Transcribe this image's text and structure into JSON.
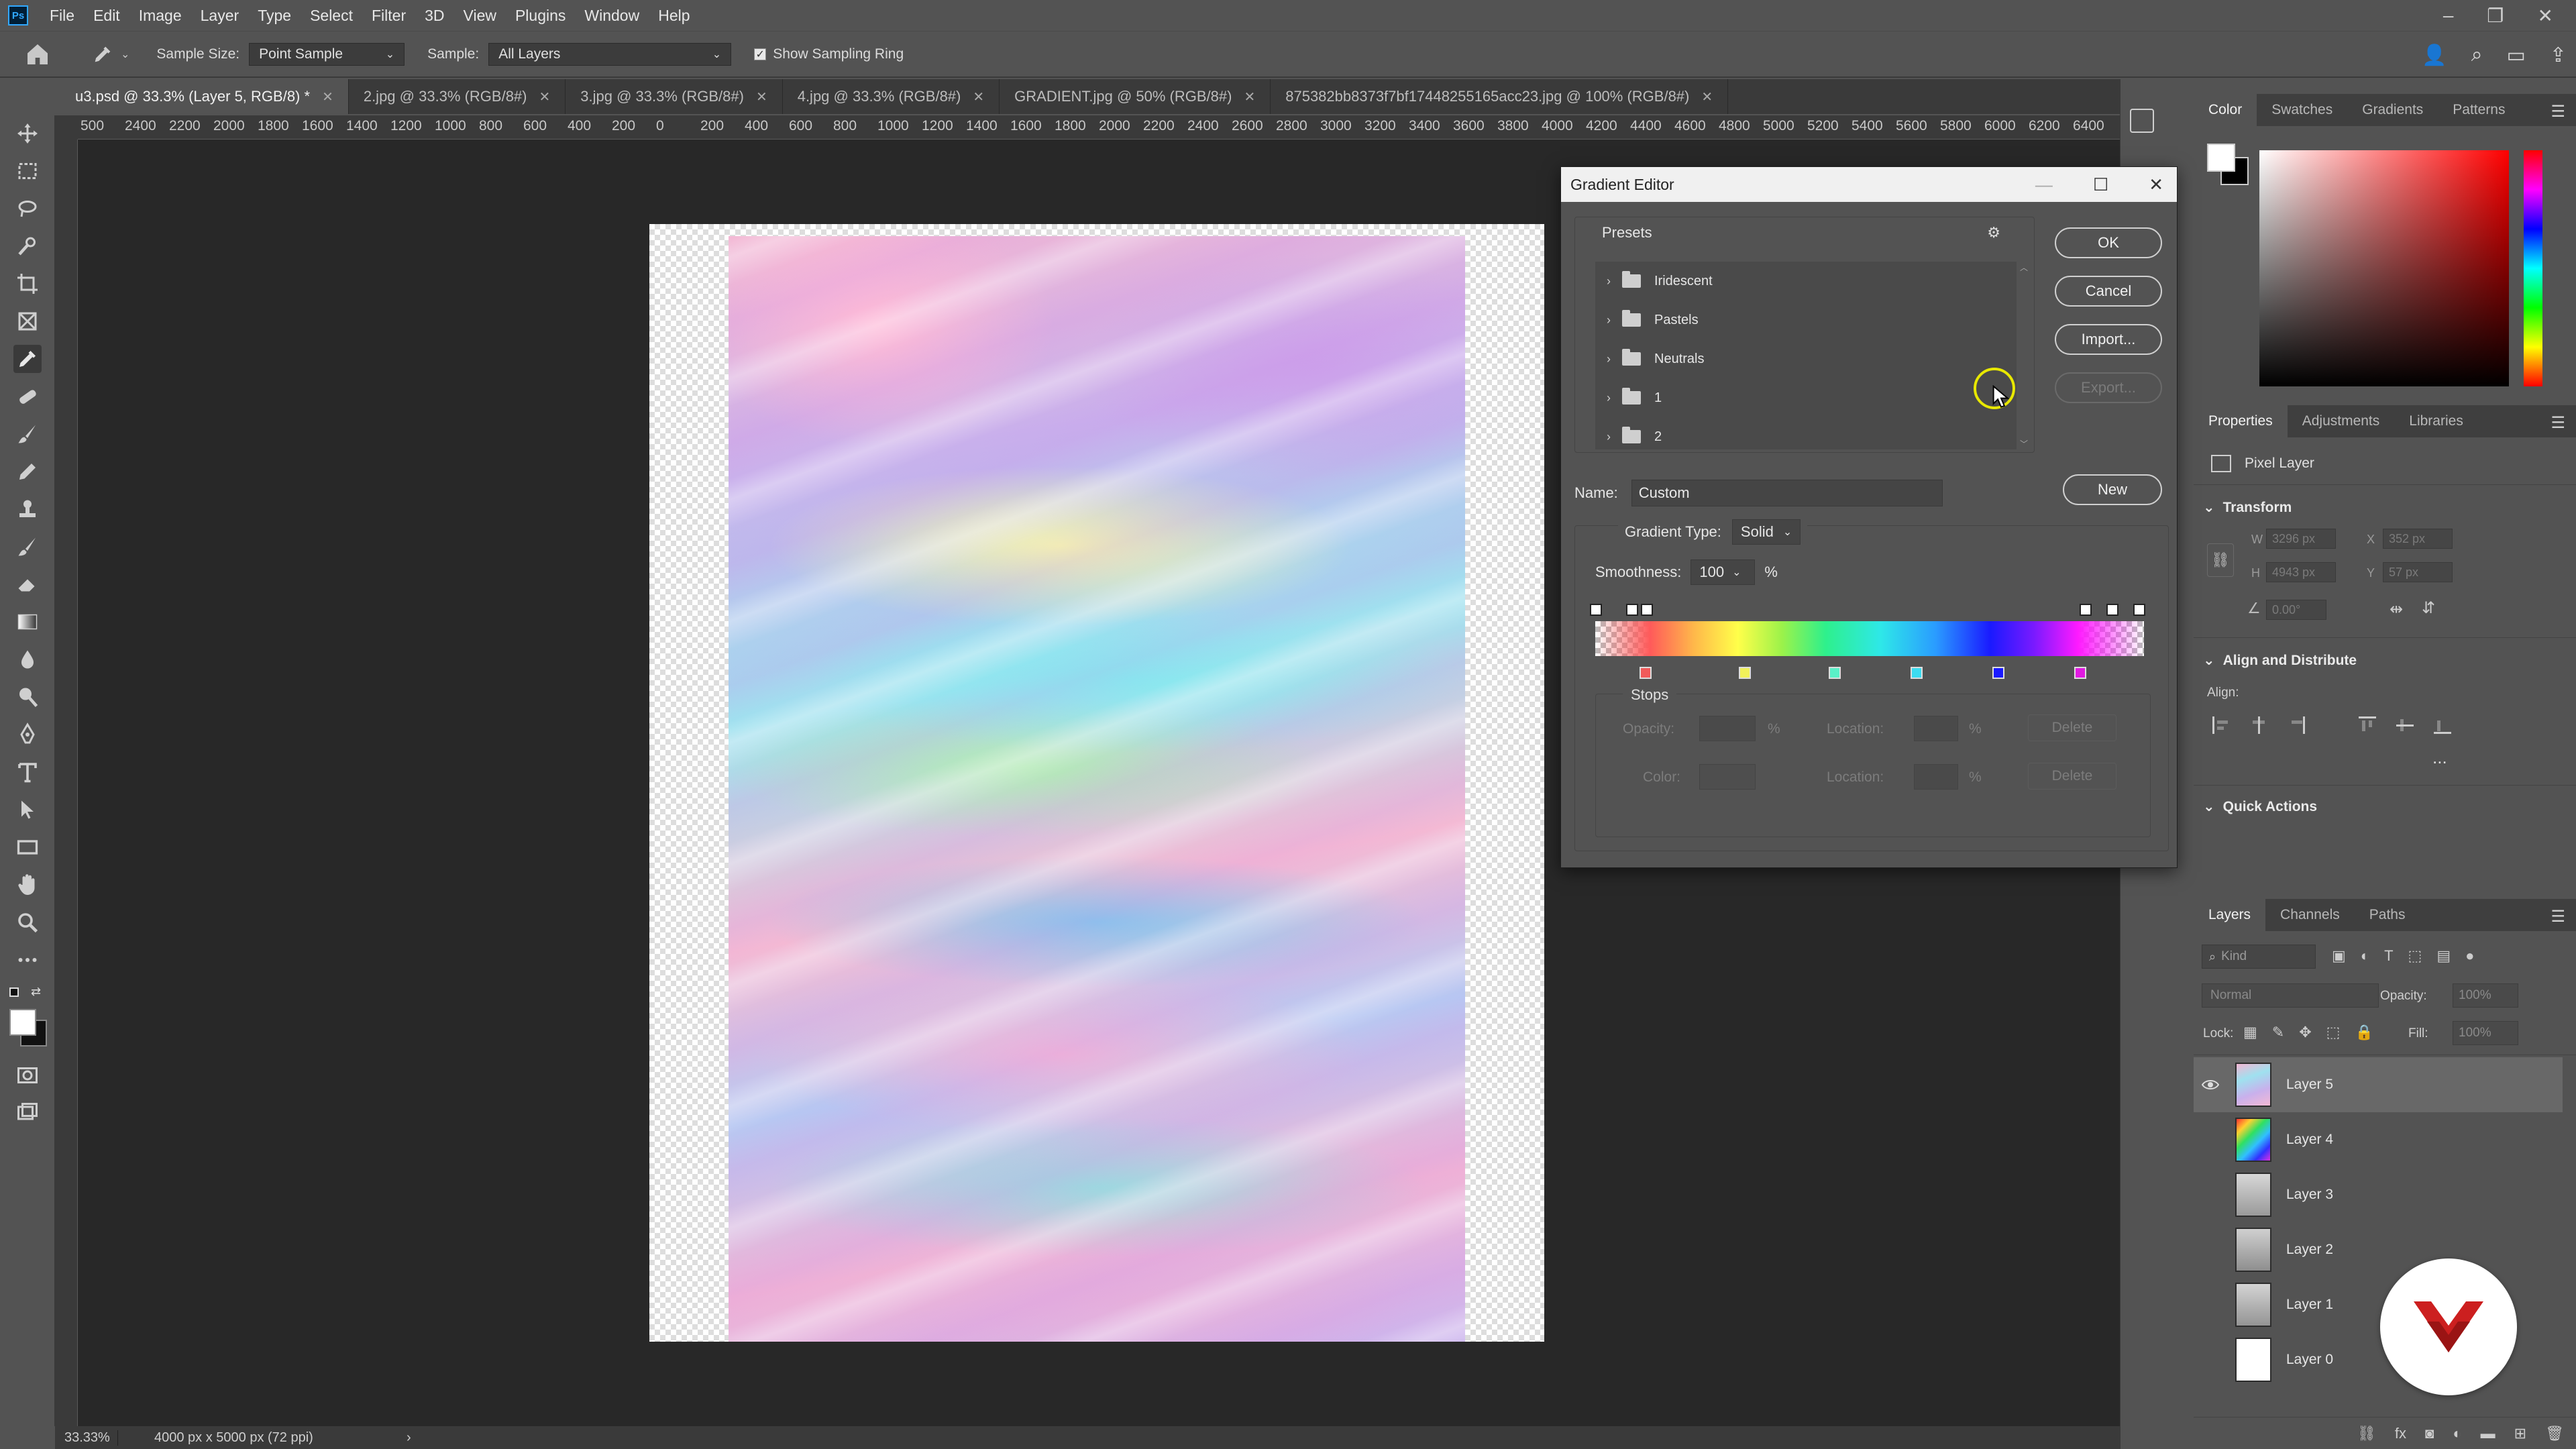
{
  "app": {
    "logo_text": "Ps",
    "menu": [
      "File",
      "Edit",
      "Image",
      "Layer",
      "Type",
      "Select",
      "Filter",
      "3D",
      "View",
      "Plugins",
      "Window",
      "Help"
    ]
  },
  "options_bar": {
    "sample_size_label": "Sample Size:",
    "sample_size_value": "Point Sample",
    "sample_label": "Sample:",
    "sample_value": "All Layers",
    "show_sampling_ring_label": "Show Sampling Ring",
    "show_sampling_ring_checked": true
  },
  "tabs": [
    {
      "label": "u3.psd @ 33.3% (Layer 5, RGB/8) *",
      "active": true
    },
    {
      "label": "2.jpg @ 33.3% (RGB/8#)",
      "active": false
    },
    {
      "label": "3.jpg @ 33.3% (RGB/8#)",
      "active": false
    },
    {
      "label": "4.jpg @ 33.3% (RGB/8#)",
      "active": false
    },
    {
      "label": "GRADIENT.jpg @ 50% (RGB/8#)",
      "active": false
    },
    {
      "label": "875382bb8373f7bf17448255165acc23.jpg @ 100% (RGB/8#)",
      "active": false
    }
  ],
  "ruler_labels": [
    "500",
    "2400",
    "2200",
    "2000",
    "1800",
    "1600",
    "1400",
    "1200",
    "1000",
    "800",
    "600",
    "400",
    "200",
    "0",
    "200",
    "400",
    "600",
    "800",
    "1000",
    "1200",
    "1400",
    "1600",
    "1800",
    "2000",
    "2200",
    "2400",
    "2600",
    "2800",
    "3000",
    "3200",
    "3400",
    "3600",
    "3800",
    "4000",
    "4200",
    "4400",
    "4600",
    "4800",
    "5000",
    "5200",
    "5400",
    "5600",
    "5800",
    "6000",
    "6200",
    "6400"
  ],
  "status_bar": {
    "zoom": "33.33%",
    "doc_info": "4000 px x 5000 px (72 ppi)",
    "arrow": "›"
  },
  "gradient_editor": {
    "title": "Gradient Editor",
    "presets_label": "Presets",
    "presets": [
      "Iridescent",
      "Pastels",
      "Neutrals",
      "1",
      "2"
    ],
    "buttons": {
      "ok": "OK",
      "cancel": "Cancel",
      "import": "Import...",
      "export": "Export...",
      "new": "New"
    },
    "name_label": "Name:",
    "name_value": "Custom",
    "gradient_type_label": "Gradient Type:",
    "gradient_type_value": "Solid",
    "smoothness_label": "Smoothness:",
    "smoothness_value": "100",
    "percent": "%",
    "stops_label": "Stops",
    "opacity_label": "Opacity:",
    "location_label": "Location:",
    "color_label": "Color:",
    "delete_label": "Delete",
    "color_stop_colors": [
      "#f05a5a",
      "#f0f05a",
      "#5af0c8",
      "#3cdcf0",
      "#1a1aff",
      "#e01ae0"
    ]
  },
  "color_panel": {
    "tabs": [
      "Color",
      "Swatches",
      "Gradients",
      "Patterns"
    ],
    "foreground": "#ffffff",
    "background": "#000000",
    "picker_hue": "#ff0000"
  },
  "properties_panel": {
    "tabs": [
      "Properties",
      "Adjustments",
      "Libraries"
    ],
    "layer_kind": "Pixel Layer",
    "transform_label": "Transform",
    "w_label": "W",
    "w_value": "3296 px",
    "x_label": "X",
    "x_value": "352 px",
    "h_label": "H",
    "h_value": "4943 px",
    "y_label": "Y",
    "y_value": "57 px",
    "angle_value": "0.00°",
    "align_distribute_label": "Align and Distribute",
    "align_label": "Align:",
    "more": "...",
    "quick_actions_label": "Quick Actions"
  },
  "layers_panel": {
    "tabs": [
      "Layers",
      "Channels",
      "Paths"
    ],
    "kind_placeholder": "Kind",
    "blend_mode": "Normal",
    "opacity_label": "Opacity:",
    "opacity_value": "100%",
    "lock_label": "Lock:",
    "fill_label": "Fill:",
    "fill_value": "100%",
    "layers": [
      {
        "name": "Layer 5",
        "visible": true,
        "selected": true
      },
      {
        "name": "Layer 4",
        "visible": false,
        "selected": false
      },
      {
        "name": "Layer 3",
        "visible": false,
        "selected": false
      },
      {
        "name": "Layer 2",
        "visible": false,
        "selected": false
      },
      {
        "name": "Layer 1",
        "visible": false,
        "selected": false
      },
      {
        "name": "Layer 0",
        "visible": false,
        "selected": false
      }
    ]
  },
  "colors": {
    "accent_ring": "#e8e800",
    "brand_red": "#cc1f1f"
  }
}
